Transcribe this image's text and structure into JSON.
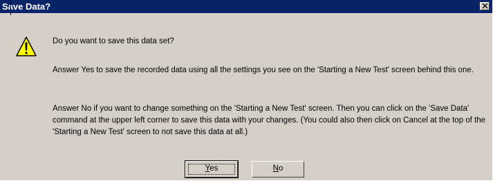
{
  "window": {
    "title": "Save Data?",
    "title_bar_color": "#0a246a",
    "close_icon": "close-icon"
  },
  "message": {
    "icon": "warning-icon",
    "question": "Do you want to save this data set?",
    "paragraph_yes": "Answer Yes to save the recorded data using all the settings you see on the 'Starting a New Test' screen behind this one.",
    "paragraph_no": "Answer No if you want to change something on the 'Starting a New Test' screen.  Then you can click on the 'Save Data' command at the upper left corner to save this data with your changes.  (You could also then click on Cancel at the top of the 'Starting a New Test' screen to not save this data at all.)"
  },
  "buttons": {
    "yes": {
      "mnemonic": "Y",
      "rest": "es"
    },
    "no": {
      "mnemonic": "N",
      "rest": "o"
    }
  }
}
